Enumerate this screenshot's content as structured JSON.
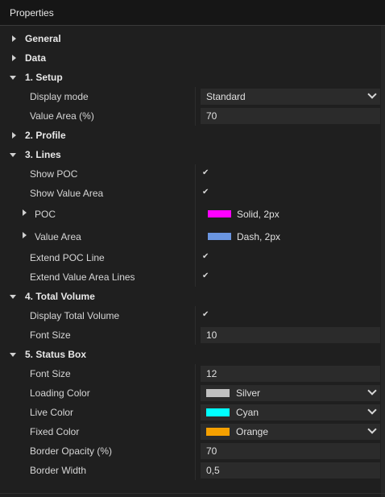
{
  "window": {
    "title": "Properties"
  },
  "sections": {
    "general": "General",
    "data": "Data",
    "setup": "1. Setup",
    "profile": "2. Profile",
    "lines": "3. Lines",
    "total_volume": "4. Total Volume",
    "status_box": "5. Status Box"
  },
  "setup": {
    "display_mode_label": "Display mode",
    "display_mode_value": "Standard",
    "value_area_label": "Value Area (%)",
    "value_area_value": "70"
  },
  "lines": {
    "show_poc_label": "Show POC",
    "show_value_area_label": "Show Value Area",
    "poc_label": "POC",
    "poc_stroke": "Solid, 2px",
    "poc_color": "#ff00ff",
    "value_area_label": "Value Area",
    "value_area_stroke": "Dash, 2px",
    "value_area_color": "#6a95e0",
    "extend_poc_label": "Extend POC Line",
    "extend_value_area_label": "Extend Value Area Lines",
    "check_glyph": "✔"
  },
  "total_volume": {
    "display_label": "Display Total Volume",
    "font_size_label": "Font Size",
    "font_size_value": "10"
  },
  "status_box": {
    "font_size_label": "Font Size",
    "font_size_value": "12",
    "loading_color_label": "Loading Color",
    "loading_color_value": "Silver",
    "loading_color_hex": "#c0c0c0",
    "live_color_label": "Live Color",
    "live_color_value": "Cyan",
    "live_color_hex": "#00ffff",
    "fixed_color_label": "Fixed Color",
    "fixed_color_value": "Orange",
    "fixed_color_hex": "#f5a000",
    "border_opacity_label": "Border Opacity (%)",
    "border_opacity_value": "70",
    "border_width_label": "Border Width",
    "border_width_value": "0,5"
  }
}
